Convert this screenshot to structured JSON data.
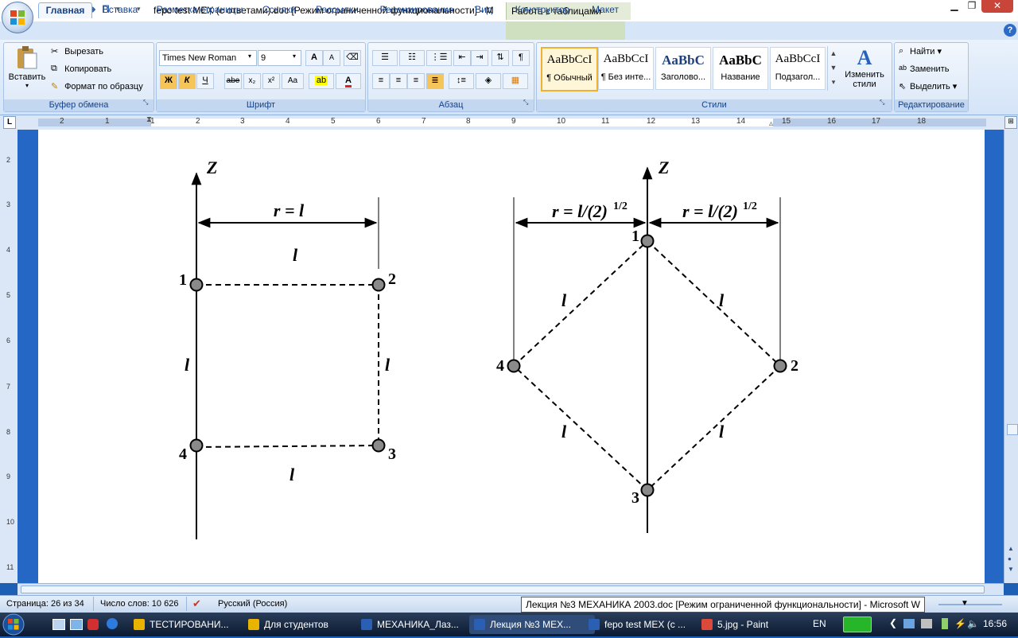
{
  "titlebar": {
    "document_title": "fepo test MEX (с ответами).doc [Режим ограниченной функциональности] - M",
    "context_tools_label": "Работа с таблицами",
    "minimize_glyph": "▁",
    "maximize_glyph": "❐",
    "close_glyph": "✕"
  },
  "tabs": [
    {
      "label": "Главная",
      "active": true
    },
    {
      "label": "Вставка"
    },
    {
      "label": "Разметка страницы"
    },
    {
      "label": "Ссылки"
    },
    {
      "label": "Рассылки"
    },
    {
      "label": "Рецензирование"
    },
    {
      "label": "Вид"
    },
    {
      "label": "Конструктор"
    },
    {
      "label": "Макет"
    }
  ],
  "ribbon": {
    "clipboard": {
      "title": "Буфер обмена",
      "paste": "Вставить",
      "cut": "Вырезать",
      "copy": "Копировать",
      "format_painter": "Формат по образцу"
    },
    "font": {
      "title": "Шрифт",
      "font_name": "Times New Roman",
      "font_size": "9",
      "bold": "Ж",
      "italic": "К",
      "underline": "Ч",
      "strike": "abe",
      "subscript": "x₂",
      "superscript": "x²",
      "change_case": "Aa",
      "grow": "A",
      "shrink": "A"
    },
    "paragraph": {
      "title": "Абзац"
    },
    "styles": {
      "title": "Стили",
      "items": [
        {
          "preview": "AaBbCcI",
          "label": "¶ Обычный",
          "selected": true
        },
        {
          "preview": "AaBbCcI",
          "label": "¶ Без инте..."
        },
        {
          "preview": "AaBbC",
          "label": "Заголово..."
        },
        {
          "preview": "AaBbC",
          "label": "Название"
        },
        {
          "preview": "AaBbCcI",
          "label": "Подзагол..."
        }
      ],
      "change_styles": "Изменить стили"
    },
    "editing": {
      "title": "Редактирование",
      "find": "Найти",
      "replace": "Заменить",
      "select": "Выделить"
    }
  },
  "ruler": {
    "numbers": [
      "2",
      "1",
      "1",
      "2",
      "3",
      "4",
      "5",
      "6",
      "7",
      "8",
      "9",
      "10",
      "11",
      "12",
      "13",
      "14",
      "15",
      "16",
      "17",
      "18"
    ]
  },
  "vruler": {
    "numbers": [
      "2",
      "3",
      "4",
      "5",
      "6",
      "7",
      "8",
      "9",
      "10",
      "11"
    ]
  },
  "diagram": {
    "left": {
      "axis": "Z",
      "r_label": "r = l",
      "edge_label": "l",
      "nodes": [
        "1",
        "2",
        "3",
        "4"
      ]
    },
    "right": {
      "axis": "Z",
      "r_label_left": "r = l/(2)",
      "r_label_right": "r = l/(2)",
      "exponent": "1/2",
      "edge_label": "l",
      "nodes": [
        "1",
        "2",
        "3",
        "4"
      ]
    }
  },
  "statusbar": {
    "page": "Страница: 26 из 34",
    "words": "Число слов: 10 626",
    "language": "Русский (Россия)",
    "tooltip": "Лекция №3 МЕХАНИКА 2003.doc [Режим ограниченной функциональности] - Microsoft W"
  },
  "taskbar": {
    "tasks": [
      {
        "label": "ТЕСТИРОВАНИ...",
        "color": "#e8b400"
      },
      {
        "label": "Для студентов",
        "color": "#e8b400"
      },
      {
        "label": "МЕХАНИКА_Лаз...",
        "color": "#2b5fb3"
      },
      {
        "label": "Лекция №3 МЕХ...",
        "color": "#2b5fb3"
      },
      {
        "label": "fepo test MEX (с ...",
        "color": "#2b5fb3"
      },
      {
        "label": "5.jpg - Paint",
        "color": "#d94a3a"
      }
    ],
    "lang": "EN",
    "clock": "16:56"
  }
}
